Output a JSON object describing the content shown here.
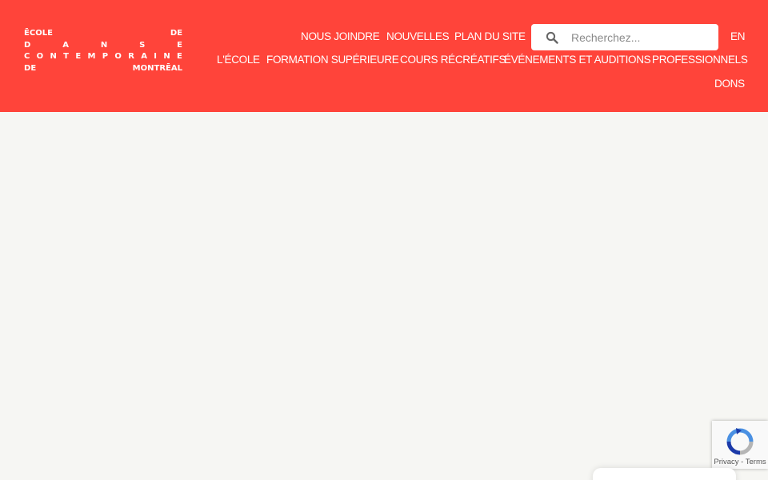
{
  "logo": {
    "rows": [
      [
        "Ē",
        "C",
        "O",
        "L",
        "E",
        "",
        "",
        "",
        "",
        "",
        "D",
        "E"
      ],
      [
        "D",
        "",
        "A",
        "",
        "N",
        "",
        "S",
        "",
        "E"
      ],
      [
        "C",
        "O",
        "N",
        "T",
        "E",
        "M",
        "P",
        "O",
        "R",
        "A",
        "I",
        "N",
        "E"
      ],
      [
        "D",
        "E",
        "",
        "",
        "M",
        "O",
        "N",
        "T",
        "R",
        "Ē",
        "A",
        "L"
      ]
    ]
  },
  "utility_nav": {
    "contact": "NOUS JOINDRE",
    "news": "NOUVELLES",
    "sitemap": "PLAN DU SITE",
    "language": "EN"
  },
  "search": {
    "placeholder": "Recherchez..."
  },
  "main_nav": {
    "school": "L'ÉCOLE",
    "training": "FORMATION SUPÉRIEURE",
    "recreational": "COURS RÉCRÉATIFS",
    "events": "ÉVÉNEMENTS ET AUDITIONS",
    "professionals": "PROFESSIONNELS",
    "donations": "DONS"
  },
  "recaptcha": {
    "terms": "Privacy - Terms"
  },
  "colors": {
    "brand_red": "#ff443a",
    "page_bg": "#f6f6f3",
    "text_on_brand": "#ffffff"
  }
}
